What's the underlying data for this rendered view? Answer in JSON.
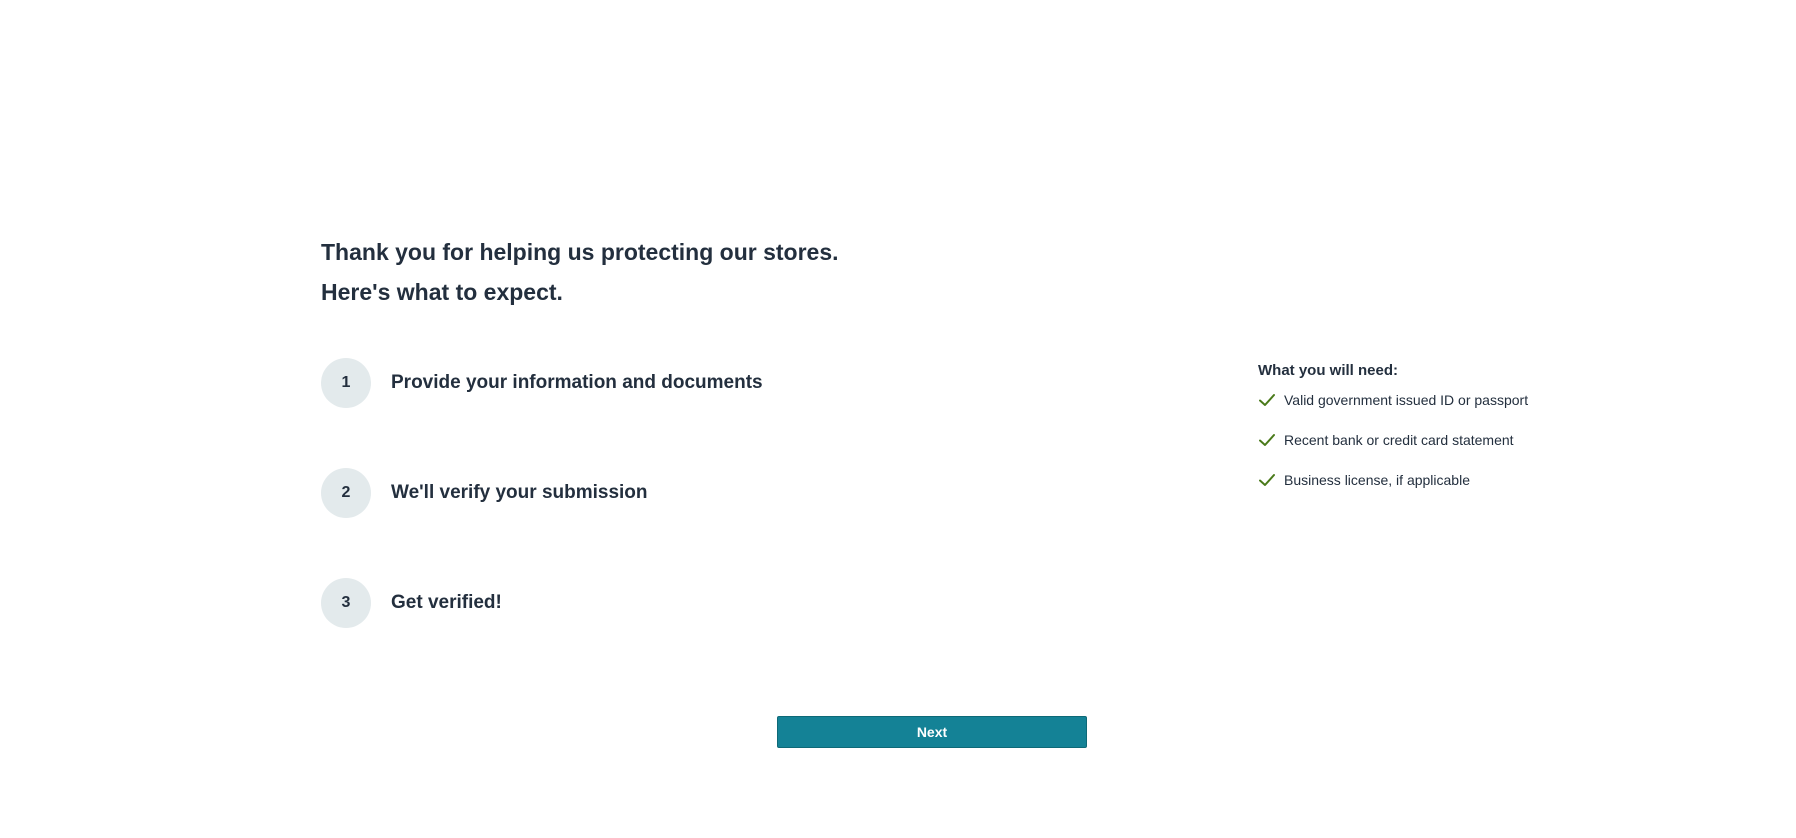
{
  "heading": {
    "line1": "Thank you for helping us protecting our stores.",
    "line2": "Here's what to expect."
  },
  "steps": [
    {
      "number": "1",
      "label": "Provide your information and documents"
    },
    {
      "number": "2",
      "label": "We'll verify your submission"
    },
    {
      "number": "3",
      "label": "Get verified!"
    }
  ],
  "requirements": {
    "title": "What you will need:",
    "icon": "check-icon",
    "check_color": "#4a7a1a",
    "items": [
      "Valid government issued ID or passport",
      "Recent bank or credit card statement",
      "Business license, if applicable"
    ]
  },
  "actions": {
    "next_label": "Next",
    "button_color": "#148296"
  }
}
